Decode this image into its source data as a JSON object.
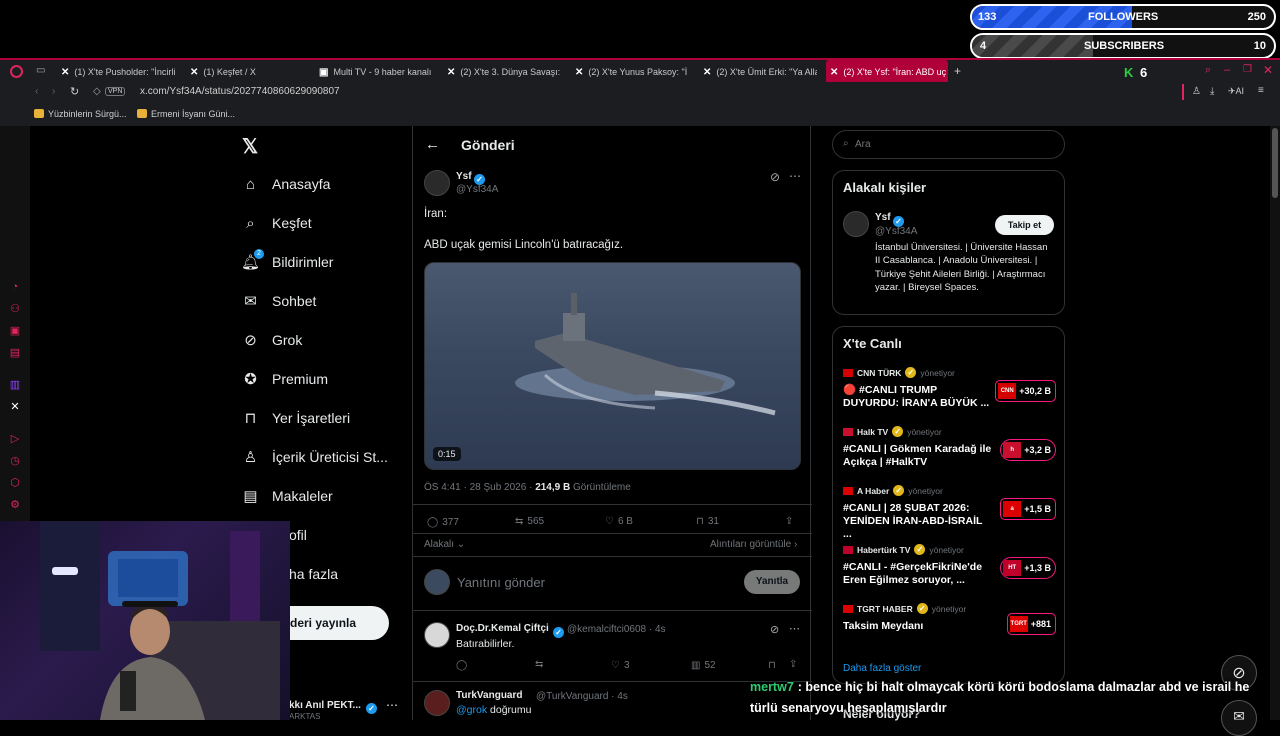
{
  "overlay": {
    "followers": {
      "current": "133",
      "label": "FOLLOWERS",
      "goal": "250",
      "progress": 0.53
    },
    "subscribers": {
      "current": "4",
      "label": "SUBSCRIBERS",
      "goal": "10",
      "progress": 0.4
    },
    "chat_user": "mertw7",
    "chat_message": ": bence hiç bi halt olmaycak körü körü bodoslama dalmazlar abd ve israil he türlü senaryoyu hesaplamışlardır"
  },
  "browser": {
    "tabs": [
      {
        "label": "(1) X'te Pusholder: \"İncirlik",
        "icon": "x-logo-icon"
      },
      {
        "label": "(1) Keşfet / X",
        "icon": "x-logo-icon"
      },
      {
        "label": "Multi TV - 9 haber kanalın",
        "icon": "tv-icon"
      },
      {
        "label": "(2) X'te 3. Dünya Savaşı: \"",
        "icon": "x-logo-icon"
      },
      {
        "label": "(2) X'te Yunus Paksoy: \"İ",
        "icon": "x-logo-icon"
      },
      {
        "label": "(2) X'te Ümit Erki: \"Ya Alla",
        "icon": "x-logo-icon"
      },
      {
        "label": "(2) X'te Ysf: \"İran: ABD uç",
        "icon": "x-logo-icon",
        "active": true
      }
    ],
    "url": "x.com/Ysf34A/status/2027740860629090807",
    "vpn_label": "VPN",
    "ai_label": "AI",
    "bookmarks": [
      "Yüzbinlerin Sürgü...",
      "Ermeni İsyanı Güni..."
    ]
  },
  "nav": {
    "items": [
      {
        "label": "Anasayfa",
        "icon": "home-icon"
      },
      {
        "label": "Keşfet",
        "icon": "search-icon"
      },
      {
        "label": "Bildirimler",
        "icon": "bell-icon",
        "badge": "2"
      },
      {
        "label": "Sohbet",
        "icon": "mail-icon"
      },
      {
        "label": "Grok",
        "icon": "grok-icon"
      },
      {
        "label": "Premium",
        "icon": "premium-icon"
      },
      {
        "label": "Yer İşaretleri",
        "icon": "bookmark-icon"
      },
      {
        "label": "İçerik Üreticisi St...",
        "icon": "creator-icon"
      },
      {
        "label": "Makaleler",
        "icon": "article-icon"
      },
      {
        "label": "ofil",
        "icon": "profile-icon"
      },
      {
        "label": "ha fazla",
        "icon": "more-icon"
      }
    ],
    "post_button": "deri yayınla",
    "account_name": "kkı Anıl PEKT...",
    "account_handle": "ARKTAS"
  },
  "post": {
    "header": "Gönderi",
    "author": "Ysf",
    "handle": "@Ysf34A",
    "text_line1": "İran:",
    "text_line2": "ABD uçak gemisi Lincoln'ü batıracağız.",
    "video_time": "0:15",
    "meta_time": "ÖS 4:41 · 28 Şub 2026 · ",
    "views": "214,9 B",
    "views_label": " Görüntüleme",
    "replies": "377",
    "reposts": "565",
    "likes": "6 B",
    "bookmarks": "31",
    "related_label": "Alakalı",
    "quotes_label": "Alıntıları görüntüle",
    "reply_placeholder": "Yanıtını gönder",
    "reply_button": "Yanıtla"
  },
  "replies": [
    {
      "name": "Doç.Dr.Kemal Çiftçi",
      "handle": "@kemalciftci0608 · 4s",
      "text": "Batırabilirler.",
      "likes": "3",
      "views": "52"
    },
    {
      "name": "TurkVanguard",
      "handle": "@TurkVanguard · 4s",
      "mention": "@grok",
      "text": " doğrumu"
    }
  ],
  "right": {
    "search_placeholder": "Ara",
    "related_title": "Alakalı kişiler",
    "person": {
      "name": "Ysf",
      "handle": "@Ysf34A",
      "follow": "Takip et",
      "bio": "İstanbul Üniversitesi. | Üniversite Hassan II Casablanca. | Anadolu Üniversitesi. | Türkiye Şehit Aileleri Birliği. | Araştırmacı yazar. | Bireysel Spaces."
    },
    "live_title": "X'te Canlı",
    "hosts_label": "yönetiyor",
    "live": [
      {
        "source": "CNN TÜRK",
        "title": "🔴 #CANLI TRUMP DUYURDU: İRAN'A BÜYÜK ...",
        "count": "+30,2 B",
        "logo": "CNN"
      },
      {
        "source": "Halk TV",
        "title": "#CANLI | Gökmen Karadağ ile Açıkça | #HalkTV",
        "count": "+3,2 B",
        "logo": "h"
      },
      {
        "source": "A Haber",
        "title": "#CANLI | 28 ŞUBAT 2026: YENİDEN İRAN-ABD-İSRAİL ...",
        "count": "+1,5 B",
        "logo": "a"
      },
      {
        "source": "Habertürk TV",
        "title": "#CANLI - #GerçekFikriNe'de Eren Eğilmez soruyor, ...",
        "count": "+1,3 B",
        "logo": "HT"
      },
      {
        "source": "TGRT HABER",
        "title": "Taksim Meydanı",
        "count": "+881",
        "logo": "TGRT"
      }
    ],
    "show_more": "Daha fazla göster",
    "next_title": "Neler oluyor?"
  }
}
